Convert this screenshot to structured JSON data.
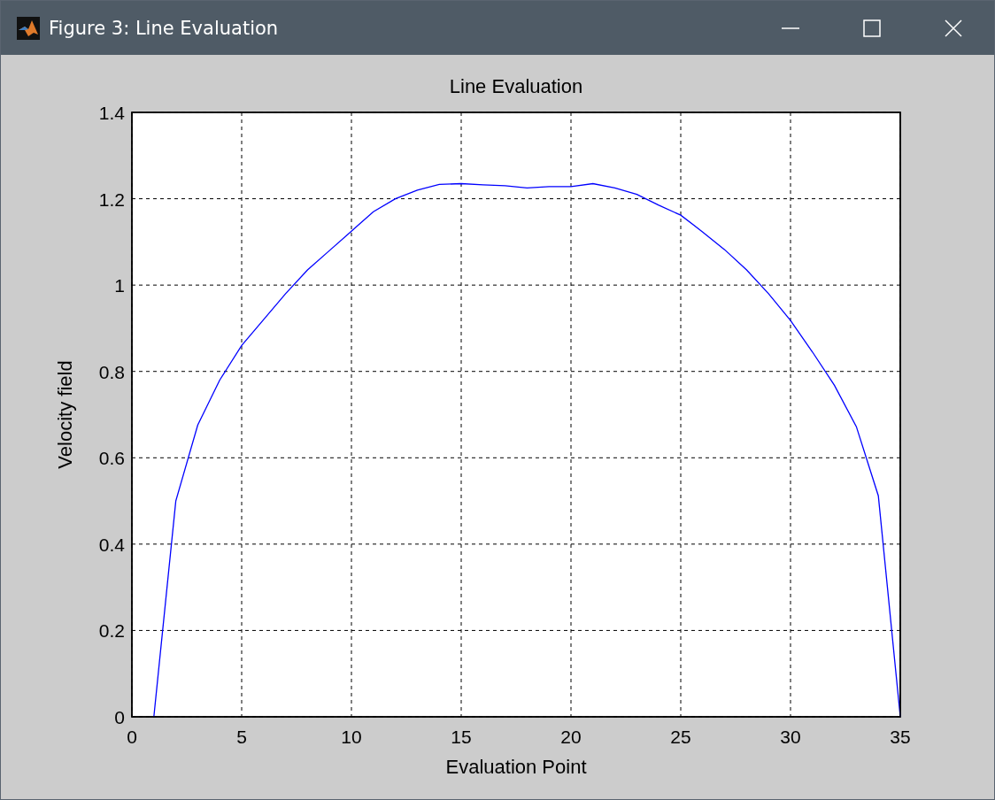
{
  "window": {
    "title": "Figure 3: Line Evaluation"
  },
  "figure": {
    "chart_data": {
      "type": "line",
      "title": "Line Evaluation",
      "xlabel": "Evaluation Point",
      "ylabel": "Velocity field",
      "xlim": [
        0,
        35
      ],
      "ylim": [
        0,
        1.4
      ],
      "xticks": [
        0,
        5,
        10,
        15,
        20,
        25,
        30,
        35
      ],
      "yticks": [
        0,
        0.2,
        0.4,
        0.6,
        0.8,
        1,
        1.2,
        1.4
      ],
      "grid": true,
      "x": [
        1,
        2,
        3,
        4,
        5,
        6,
        7,
        8,
        9,
        10,
        11,
        12,
        13,
        14,
        15,
        16,
        17,
        18,
        19,
        20,
        21,
        22,
        23,
        24,
        25,
        26,
        27,
        28,
        29,
        30,
        31,
        32,
        33,
        34,
        35
      ],
      "series": [
        {
          "color": "#0000ff",
          "values": [
            0,
            0.5,
            0.676,
            0.78,
            0.86,
            0.92,
            0.98,
            1.035,
            1.08,
            1.125,
            1.17,
            1.2,
            1.22,
            1.233,
            1.235,
            1.232,
            1.23,
            1.225,
            1.228,
            1.228,
            1.235,
            1.225,
            1.21,
            1.185,
            1.162,
            1.123,
            1.082,
            1.035,
            0.98,
            0.918,
            0.845,
            0.768,
            0.672,
            0.512,
            0
          ]
        }
      ]
    }
  }
}
